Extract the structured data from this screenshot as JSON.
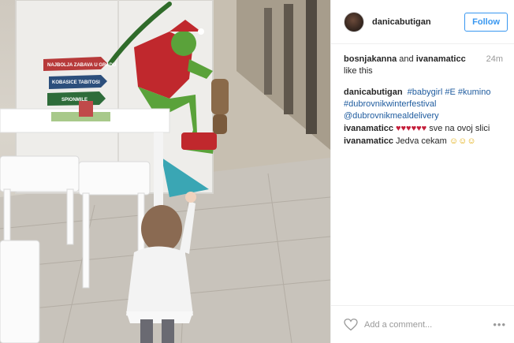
{
  "post": {
    "author": {
      "username": "danicabutigan",
      "follow_label": "Follow"
    },
    "photo": {
      "signs": [
        "NAJBOLJA ZABAVA U GRADU",
        "KOBASICE TABITOSI",
        "SPIONMILE"
      ]
    },
    "likes": {
      "user1": "bosnjakanna",
      "joiner": " and ",
      "user2": "ivanamaticc",
      "suffix": " like this"
    },
    "time_ago": "24m",
    "caption": {
      "author": "danicabutigan",
      "tags": [
        "#babygirl",
        "#E",
        "#kumino",
        "#dubrovnikwinterfestival",
        "@dubrovnikmealdelivery"
      ]
    },
    "comments": [
      {
        "author": "ivanamaticc",
        "hearts": "♥♥♥♥♥♥",
        "text": " sve na ovoj slici"
      },
      {
        "author": "ivanamaticc",
        "text": "Jedva cekam ",
        "emoji": "☺☺☺"
      }
    ],
    "footer": {
      "comment_placeholder": "Add a comment...",
      "more_label": "•••"
    }
  },
  "colors": {
    "follow_blue": "#3897f0",
    "tag_blue": "#1e5b9e",
    "heart_red": "#c41e3a"
  }
}
